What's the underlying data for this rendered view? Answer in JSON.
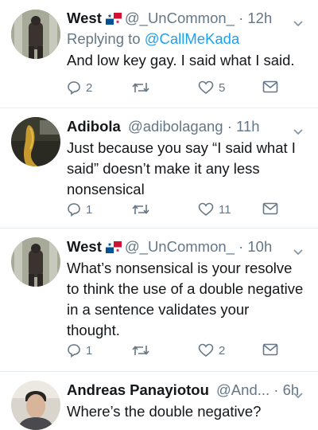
{
  "colors": {
    "text": "#14171a",
    "secondary": "#657786",
    "link": "#1da1f2",
    "divider": "#e6ecf0"
  },
  "tweets": [
    {
      "name": "West",
      "flag": "panama-flag-icon",
      "handle": "@_UnCommon_",
      "dot": "·",
      "time": "12h",
      "reply_prefix": "Replying to ",
      "reply_mention": "@CallMeKada",
      "lines": [
        "And low key gay. I said what I said."
      ],
      "replies": "2",
      "retweets": "",
      "likes": "5"
    },
    {
      "name": "Adibola",
      "handle": "@adibolagang",
      "dot": "·",
      "time": "11h",
      "lines": [
        "Just because you say “I said what I",
        "said” doesn’t make it any less",
        "nonsensical"
      ],
      "replies": "1",
      "retweets": "",
      "likes": "11"
    },
    {
      "name": "West",
      "flag": "panama-flag-icon",
      "handle": "@_UnCommon_",
      "dot": "·",
      "time": "10h",
      "lines": [
        "What’s nonsensical is your resolve",
        "to think the use of a double negative",
        "in a sentence validates your",
        "thought."
      ],
      "replies": "1",
      "retweets": "",
      "likes": "2"
    },
    {
      "name": "Andreas Panayiotou",
      "handle": "@And...",
      "dot": "·",
      "time": "6h",
      "lines": [
        "Where’s the double negative?"
      ]
    }
  ]
}
